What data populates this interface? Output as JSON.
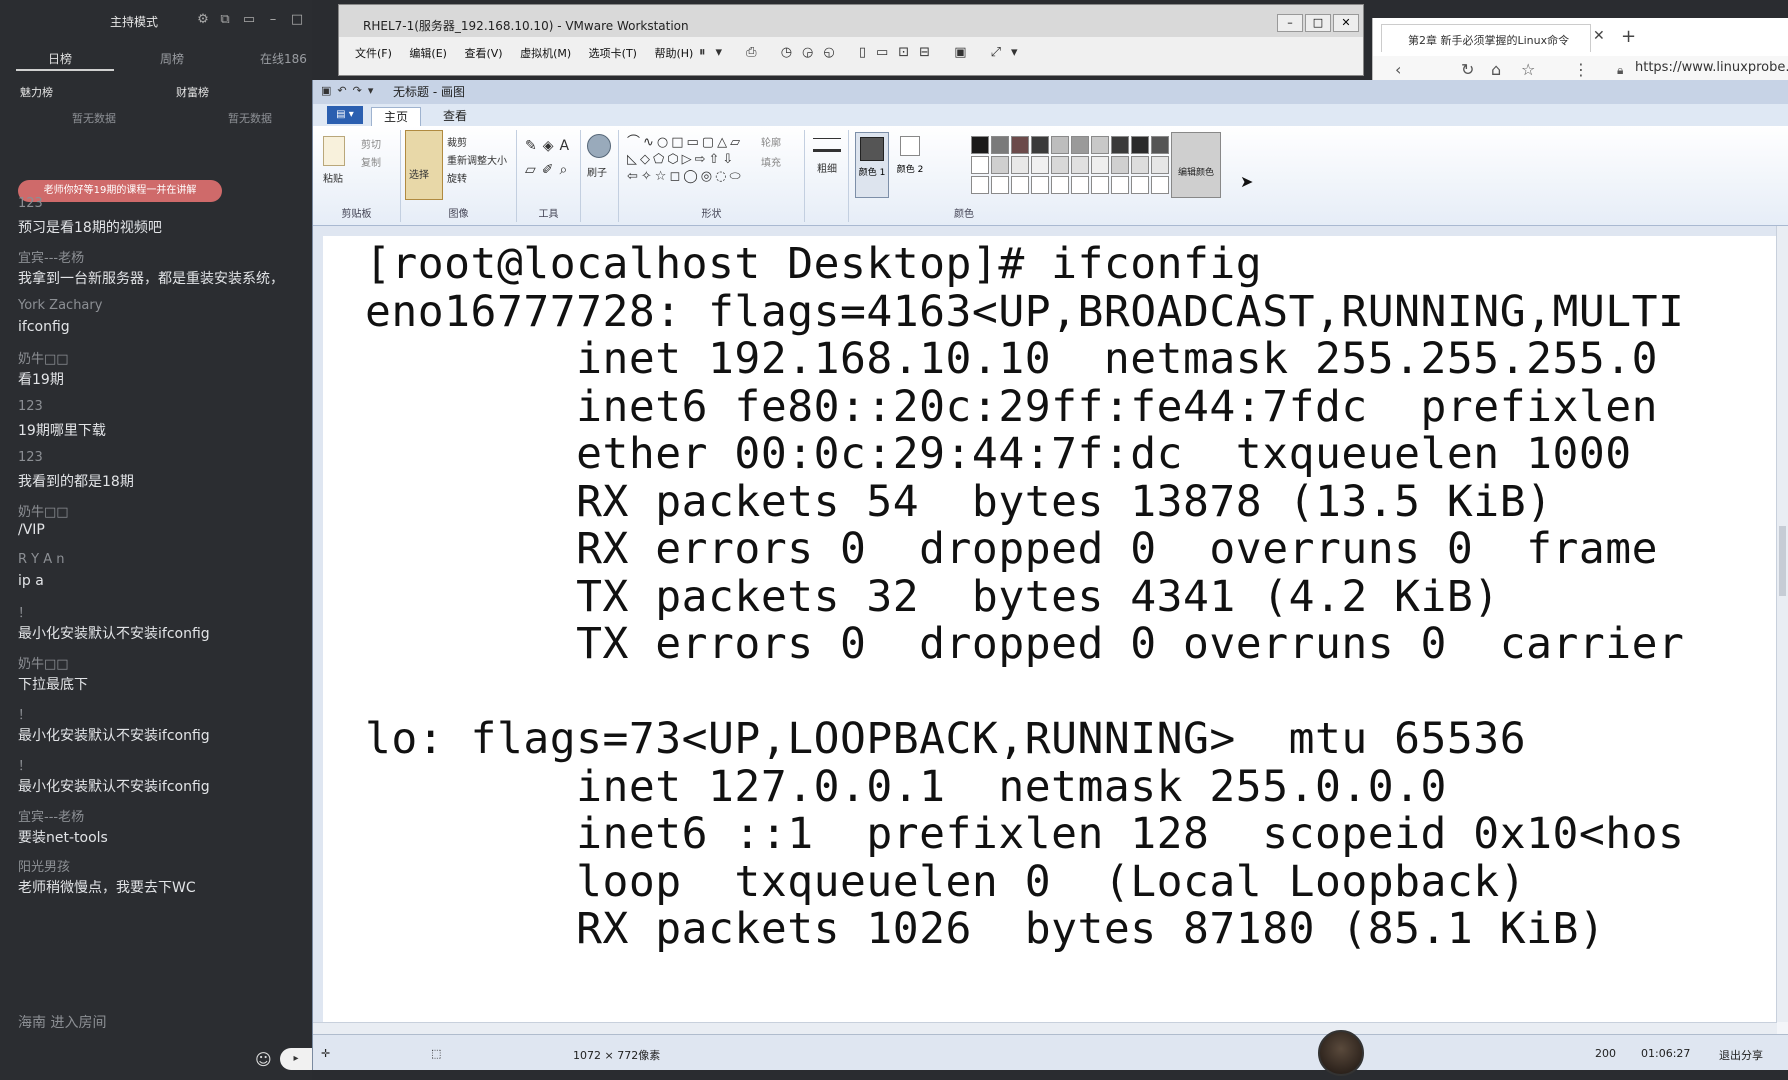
{
  "live": {
    "host_mode": "主持模式",
    "tabs": [
      "日榜",
      "周榜",
      "在线186"
    ],
    "boards": [
      "魅力榜",
      "财富榜"
    ],
    "board_empty": [
      "暂无数据",
      "暂无数据"
    ],
    "notice": "老师你好等19期的课程一并在讲解",
    "chat": [
      {
        "user": "123",
        "text": "预习是看18期的视频吧"
      },
      {
        "user": "宜宾---老杨",
        "text": "我拿到一台新服务器，都是重装安装系统，"
      },
      {
        "user": "York Zachary",
        "text": "ifconfig"
      },
      {
        "user": "奶牛□□",
        "text": "看19期"
      },
      {
        "user": "123",
        "text": "19期哪里下载"
      },
      {
        "user": "123",
        "text": "我看到的都是18期"
      },
      {
        "user": "奶牛□□",
        "text": "/VIP"
      },
      {
        "user": "R Y A n",
        "text": "ip a"
      },
      {
        "user": "！",
        "text": "最小化安装默认不安装ifconfig"
      },
      {
        "user": "奶牛□□",
        "text": "下拉最底下"
      },
      {
        "user": "！",
        "text": "最小化安装默认不安装ifconfig"
      },
      {
        "user": "！",
        "text": "最小化安装默认不安装ifconfig"
      },
      {
        "user": "宜宾---老杨",
        "text": "要装net-tools"
      },
      {
        "user": "阳光男孩",
        "text": "老师稍微慢点，我要去下WC"
      }
    ],
    "room_join": "海南 进入房间"
  },
  "vmware": {
    "title": "RHEL7-1(服务器_192.168.10.10) - VMware Workstation",
    "menus": [
      "文件(F)",
      "编辑(E)",
      "查看(V)",
      "虚拟机(M)",
      "选项卡(T)",
      "帮助(H)"
    ]
  },
  "browser": {
    "tab_title": "第2章 新手必须掌握的Linux命令",
    "url": "https://www.linuxprobe.c"
  },
  "paint": {
    "title": "无标题 - 画图",
    "tabs": [
      "主页",
      "查看"
    ],
    "clipboard": {
      "paste": "粘贴",
      "cut": "剪切",
      "copy": "复制",
      "group": "剪贴板"
    },
    "image": {
      "select": "选择",
      "crop": "裁剪",
      "resize": "重新调整大小",
      "rotate": "旋转",
      "group": "图像"
    },
    "tools_group": "工具",
    "brush": "刷子",
    "shapes_group": "形状",
    "outline": "轮廓",
    "fill": "填充",
    "size": "粗细",
    "color1": "颜色 1",
    "color2": "颜色 2",
    "colors_group": "颜色",
    "edit_colors": "编辑颜色",
    "palette": [
      "#1a1a1a",
      "#7a7a7a",
      "#6b4a4a",
      "#3a3a3a",
      "#bdbdbd",
      "#9a9a9a",
      "#c8c8c8",
      "#3a3a3a",
      "#2a2a2a",
      "#555555",
      "#ffffff",
      "#cfcfcf",
      "#e8e8e8",
      "#f0f0f0",
      "#d8d8d8",
      "#e0e0e0",
      "#eeeeee",
      "#d0d0d0",
      "#dddddd",
      "#e6e6e6",
      "#ffffff",
      "#ffffff",
      "#ffffff",
      "#ffffff",
      "#ffffff",
      "#ffffff",
      "#ffffff",
      "#ffffff",
      "#ffffff",
      "#ffffff"
    ],
    "status_size": "1072 × 772像素",
    "zoom": "200",
    "time": "01:06:27",
    "exit_share": "退出分享"
  },
  "terminal": {
    "lines": [
      "[root@localhost Desktop]# ifconfig",
      "eno16777728: flags=4163<UP,BROADCAST,RUNNING,MULTI",
      "        inet 192.168.10.10  netmask 255.255.255.0",
      "        inet6 fe80::20c:29ff:fe44:7fdc  prefixlen",
      "        ether 00:0c:29:44:7f:dc  txqueuelen 1000",
      "        RX packets 54  bytes 13878 (13.5 KiB)",
      "        RX errors 0  dropped 0  overruns 0  frame",
      "        TX packets 32  bytes 4341 (4.2 KiB)",
      "        TX errors 0  dropped 0 overruns 0  carrier",
      "",
      "lo: flags=73<UP,LOOPBACK,RUNNING>  mtu 65536",
      "        inet 127.0.0.1  netmask 255.0.0.0",
      "        inet6 ::1  prefixlen 128  scopeid 0x10<hos",
      "        loop  txqueuelen 0  (Local Loopback)",
      "        RX packets 1026  bytes 87180 (85.1 KiB)"
    ]
  }
}
